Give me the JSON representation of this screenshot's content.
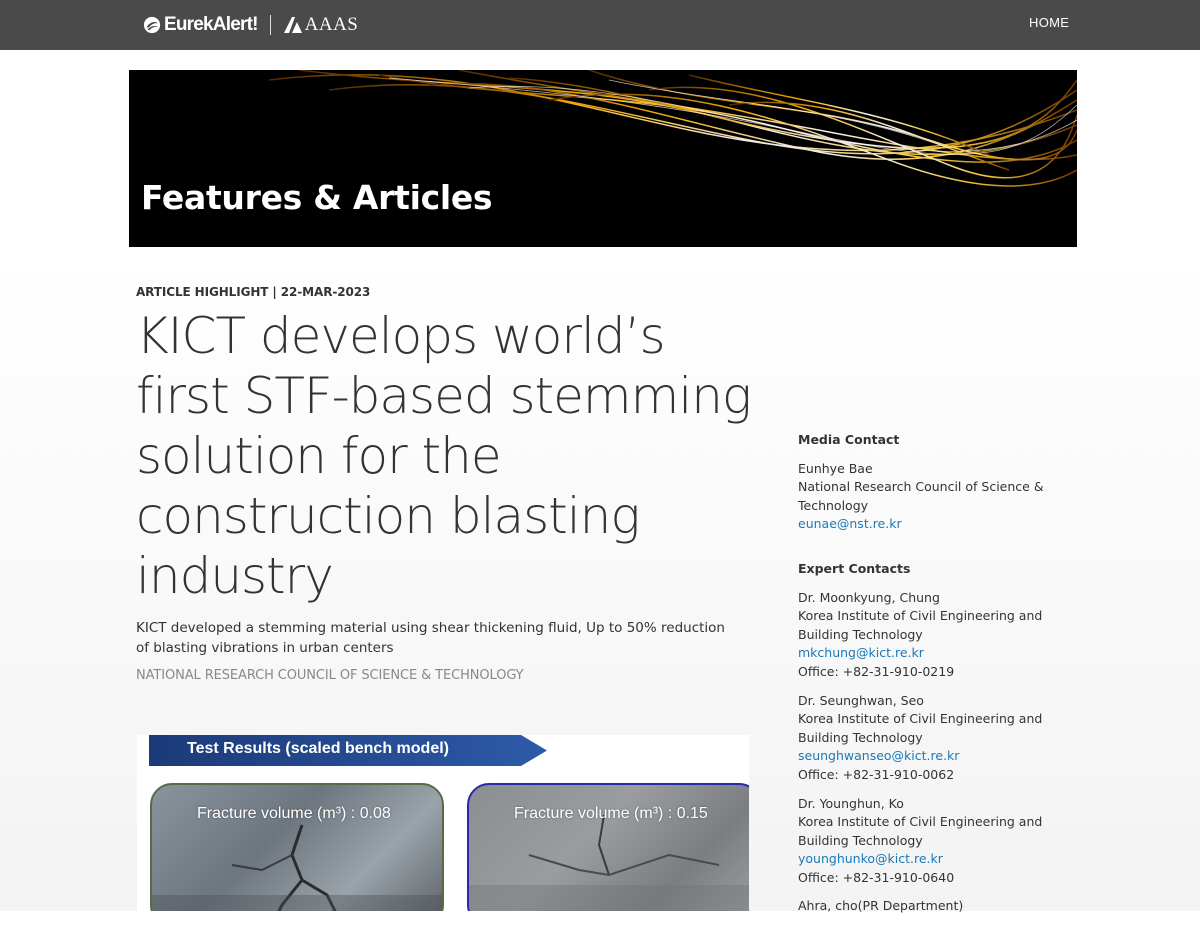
{
  "header": {
    "logo_text": "EurekAlert!",
    "partner_text": "AAAS",
    "nav_home": "HOME",
    "bar_color": "#4a4a4a"
  },
  "banner": {
    "title": "Features & Articles"
  },
  "article": {
    "meta": "ARTICLE HIGHLIGHT | 22-MAR-2023",
    "headline": "KICT develops world’s first STF-based stemming solution for the construction blasting industry",
    "subtitle": "KICT developed a stemming material using shear thickening fluid, Up to 50% reduction of blasting vibrations in urban centers",
    "source": "NATIONAL RESEARCH COUNCIL OF SCIENCE & TECHNOLOGY"
  },
  "figure": {
    "banner_text": "Test Results (scaled bench model)",
    "panels": [
      {
        "label": "Fracture volume (m³) : 0.08"
      },
      {
        "label": "Fracture volume (m³) : 0.15"
      }
    ]
  },
  "sidebar": {
    "media_contact": {
      "heading": "Media Contact",
      "name": "Eunhye Bae",
      "org": "National Research Council of Science & Technology",
      "email": "eunae@nst.re.kr"
    },
    "expert_contacts": {
      "heading": "Expert Contacts",
      "contacts": [
        {
          "name": "Dr. Moonkyung, Chung",
          "org": "Korea Institute of Civil Engineering and Building Technology",
          "email": "mkchung@kict.re.kr",
          "phone": "Office: +82-31-910-0219"
        },
        {
          "name": "Dr. Seunghwan, Seo",
          "org": "Korea Institute of Civil Engineering and Building Technology",
          "email": "seunghwanseo@kict.re.kr",
          "phone": "Office: +82-31-910-0062"
        },
        {
          "name": "Dr. Younghun, Ko",
          "org": "Korea Institute of Civil Engineering and Building Technology",
          "email": "younghunko@kict.re.kr",
          "phone": "Office: +82-31-910-0640"
        }
      ],
      "partial_next": "Ahra, cho(PR Department)"
    }
  },
  "colors": {
    "link": "#1a7ab8",
    "text": "#333333",
    "source": "#888888"
  }
}
